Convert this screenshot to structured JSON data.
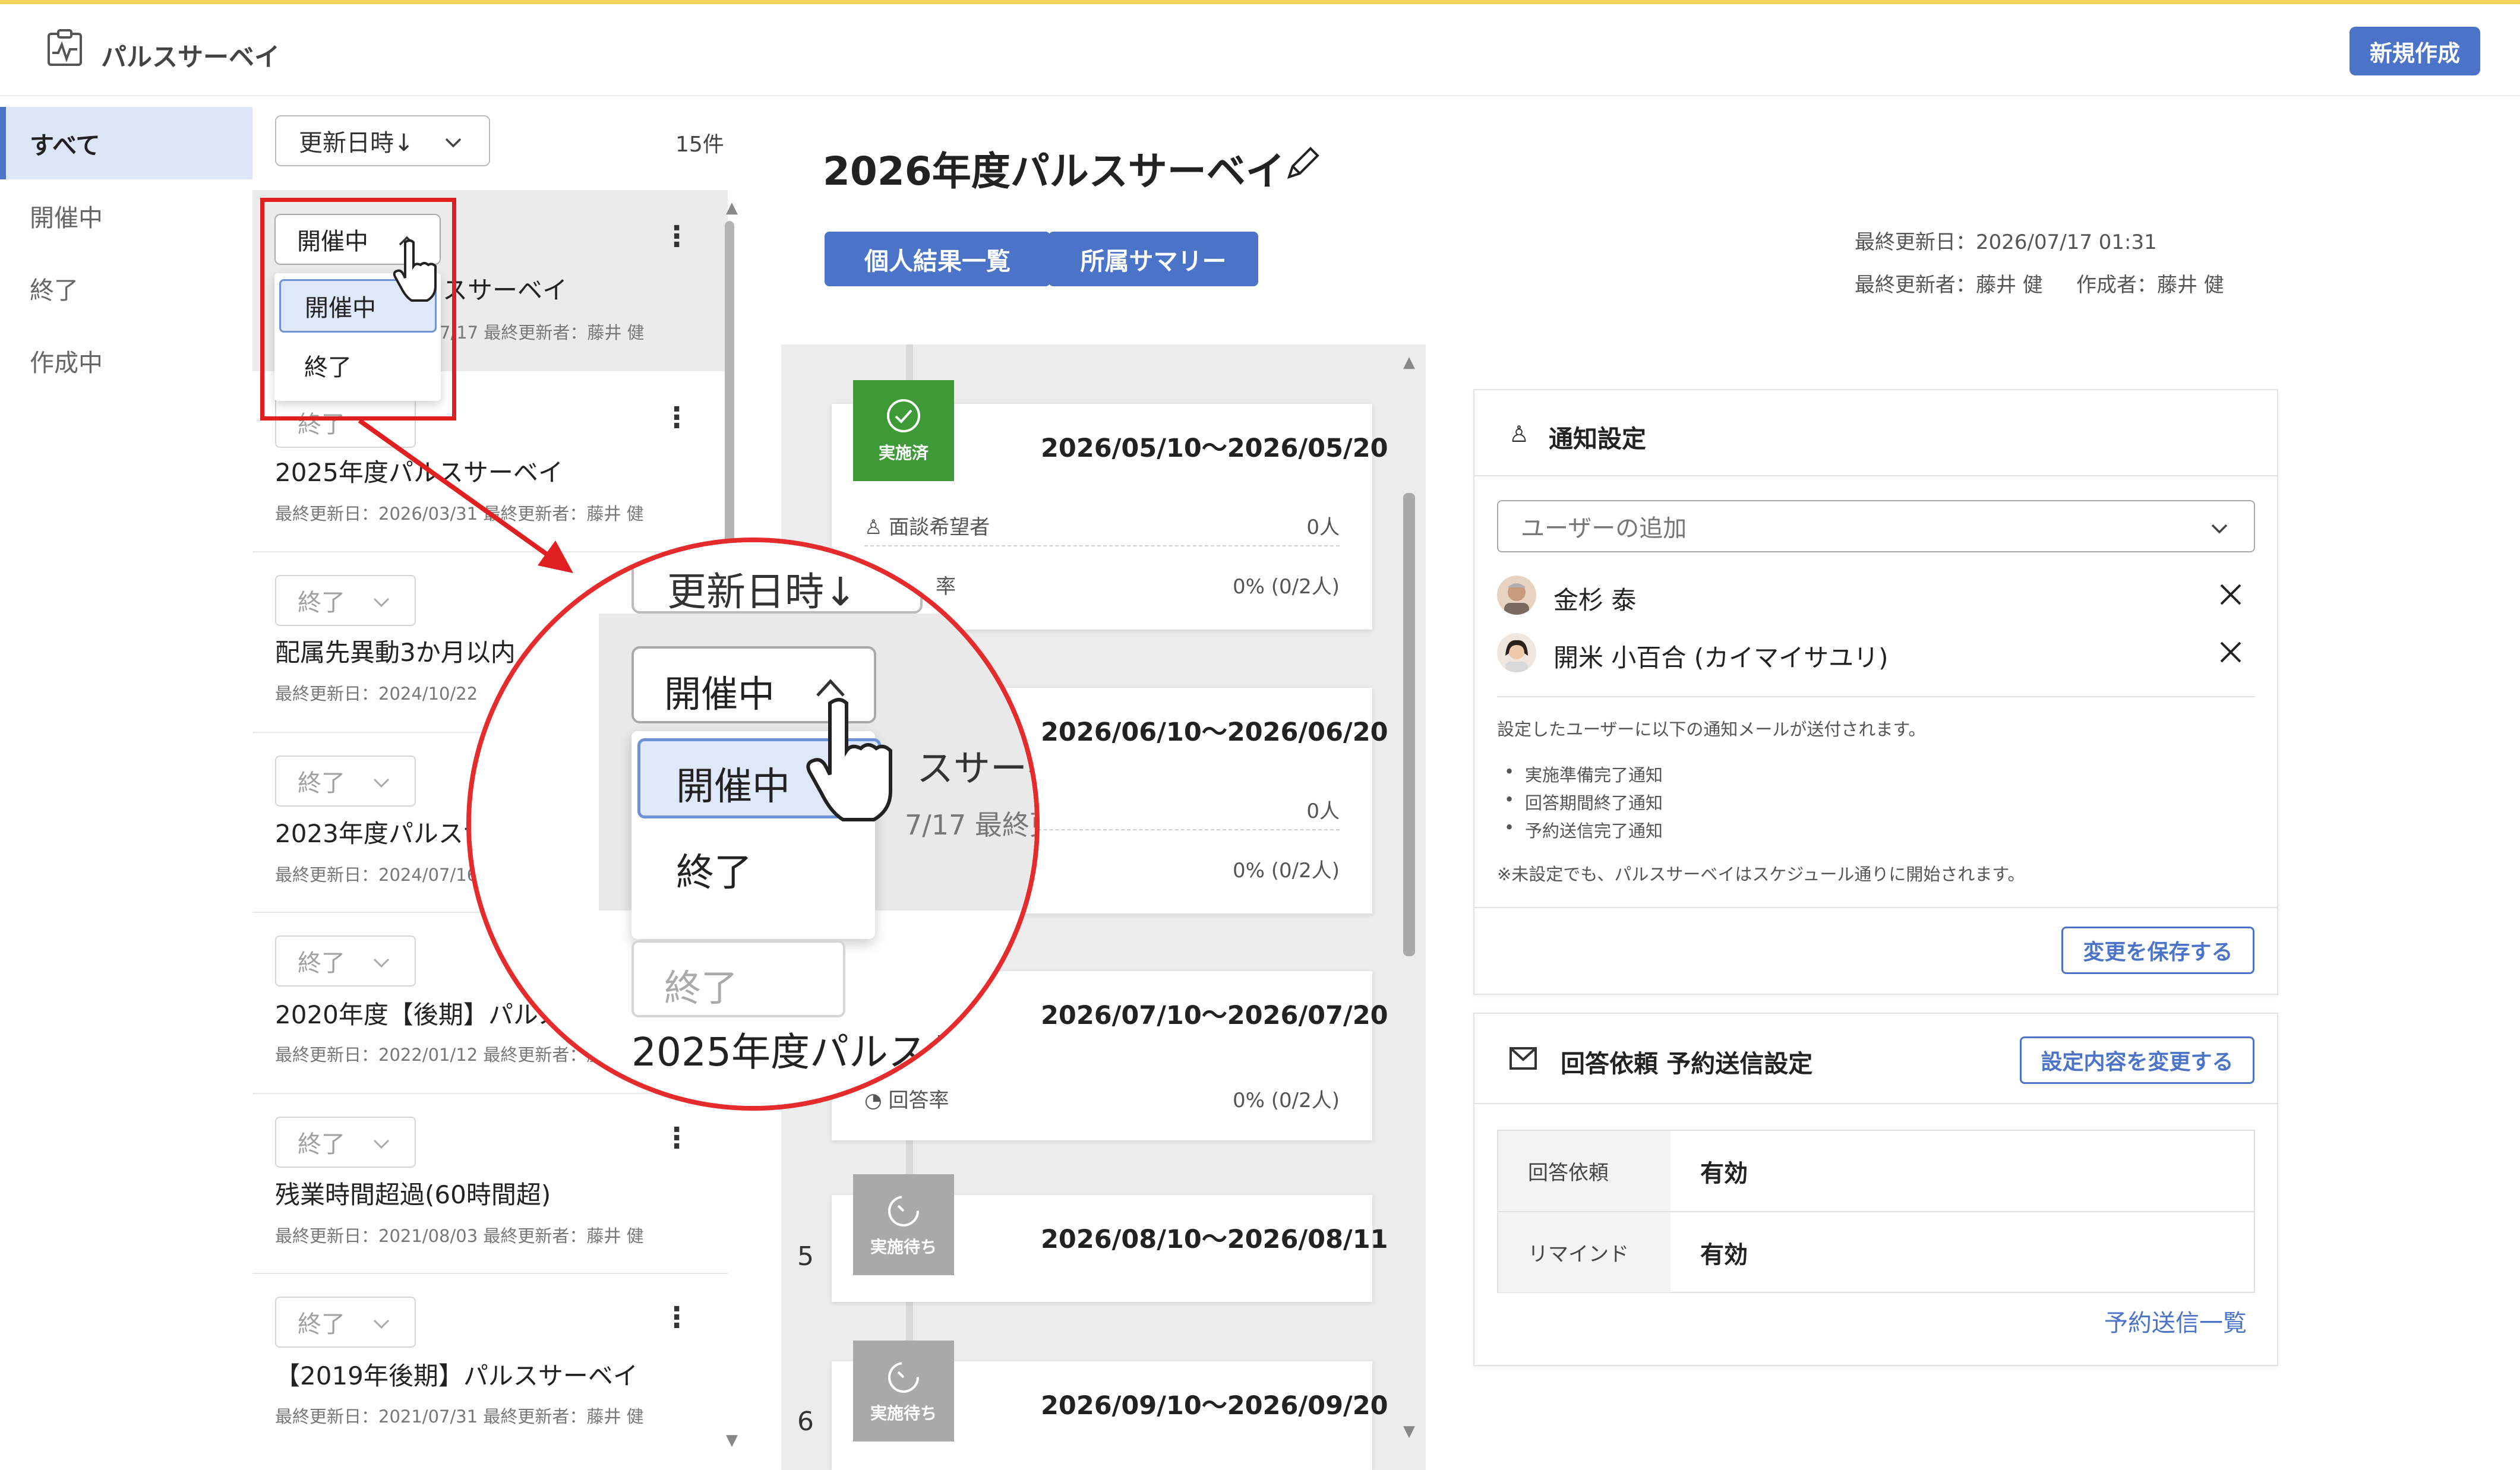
{
  "header": {
    "app_title": "パルスサーベイ",
    "new_button": "新規作成"
  },
  "nav": {
    "items": [
      "すべて",
      "開催中",
      "終了",
      "作成中"
    ]
  },
  "list": {
    "sort_label": "更新日時↓",
    "count": "15件",
    "items": [
      {
        "status": "開催中",
        "title": "2026年度パルスサーベイ",
        "meta": "最終更新日：2026/07/17  最終更新者：藤井 健"
      },
      {
        "status": "終了",
        "title": "2025年度パルスサーベイ",
        "meta": "最終更新日：2026/03/31  最終更新者：藤井 健"
      },
      {
        "status": "終了",
        "title": "配属先異動3か月以内",
        "meta": "最終更新日：2024/10/22"
      },
      {
        "status": "終了",
        "title": "2023年度パルスサ",
        "meta": "最終更新日：2024/07/16"
      },
      {
        "status": "終了",
        "title": "2020年度【後期】パルス",
        "meta": "最終更新日：2022/01/12  最終更新者：藤井"
      },
      {
        "status": "終了",
        "title": "残業時間超過(60時間超)",
        "meta": "最終更新日：2021/08/03  最終更新者：藤井 健"
      },
      {
        "status": "終了",
        "title": "【2019年後期】パルスサーベイ",
        "meta": "最終更新日：2021/07/31  最終更新者：藤井 健"
      }
    ],
    "status_dropdown": {
      "current": "開催中",
      "options": [
        "開催中",
        "終了"
      ]
    },
    "partial_title_fragment": "スサーベイ",
    "partial_meta_fragment": "7/17  最終更新者：藤井 健"
  },
  "detail": {
    "title": "2026年度パルスサーベイ",
    "tab_individual": "個人結果一覧",
    "tab_summary": "所属サマリー",
    "last_updated": "最終更新日：2026/07/17 01:31",
    "updated_by": "最終更新者：藤井 健",
    "created_by": "作成者：藤井 健"
  },
  "timeline": {
    "cards": [
      {
        "badge": "実施済",
        "date": "2026/05/10〜2026/05/20",
        "row1_label": "面談希望者",
        "row1_value": "0人",
        "row2_label": "率",
        "row2_value": "0% (0/2人)"
      },
      {
        "date": "2026/06/10〜2026/06/20",
        "row1_value": "0人",
        "row2_value": "0% (0/2人)"
      },
      {
        "date": "2026/07/10〜2026/07/20",
        "row2_label": "回答率",
        "row2_value": "0% (0/2人)"
      },
      {
        "step": "5",
        "badge": "実施待ち",
        "date": "2026/08/10〜2026/08/11"
      },
      {
        "step": "6",
        "badge": "実施待ち",
        "date": "2026/09/10〜2026/09/20"
      }
    ]
  },
  "notify": {
    "title": "通知設定",
    "user_add_placeholder": "ユーザーの追加",
    "users": [
      "金杉 泰",
      "開米 小百合 (カイマイサユリ)"
    ],
    "note": "設定したユーザーに以下の通知メールが送付されます。",
    "bullets": [
      "実施準備完了通知",
      "回答期間終了通知",
      "予約送信完了通知"
    ],
    "footnote": "※未設定でも、パルスサーベイはスケジュール通りに開始されます。",
    "save_button": "変更を保存する"
  },
  "schedule": {
    "title": "回答依頼 予約送信設定",
    "change_button": "設定内容を変更する",
    "rows": [
      {
        "k": "回答依頼",
        "v": "有効"
      },
      {
        "k": "リマインド",
        "v": "有効"
      }
    ],
    "link": "予約送信一覧"
  },
  "magnifier": {
    "sort_label": "更新日時↓",
    "status_current": "開催中",
    "options": [
      "開催中",
      "終了"
    ],
    "partial_title": "スサーベ",
    "partial_meta": "7/17  最終更",
    "next_status": "終了",
    "next_title": "2025年度パルスサ"
  },
  "colors": {
    "accent": "#4b74c8",
    "done": "#3e9a37",
    "wait": "#a9a9a9",
    "callout": "#e02020"
  }
}
